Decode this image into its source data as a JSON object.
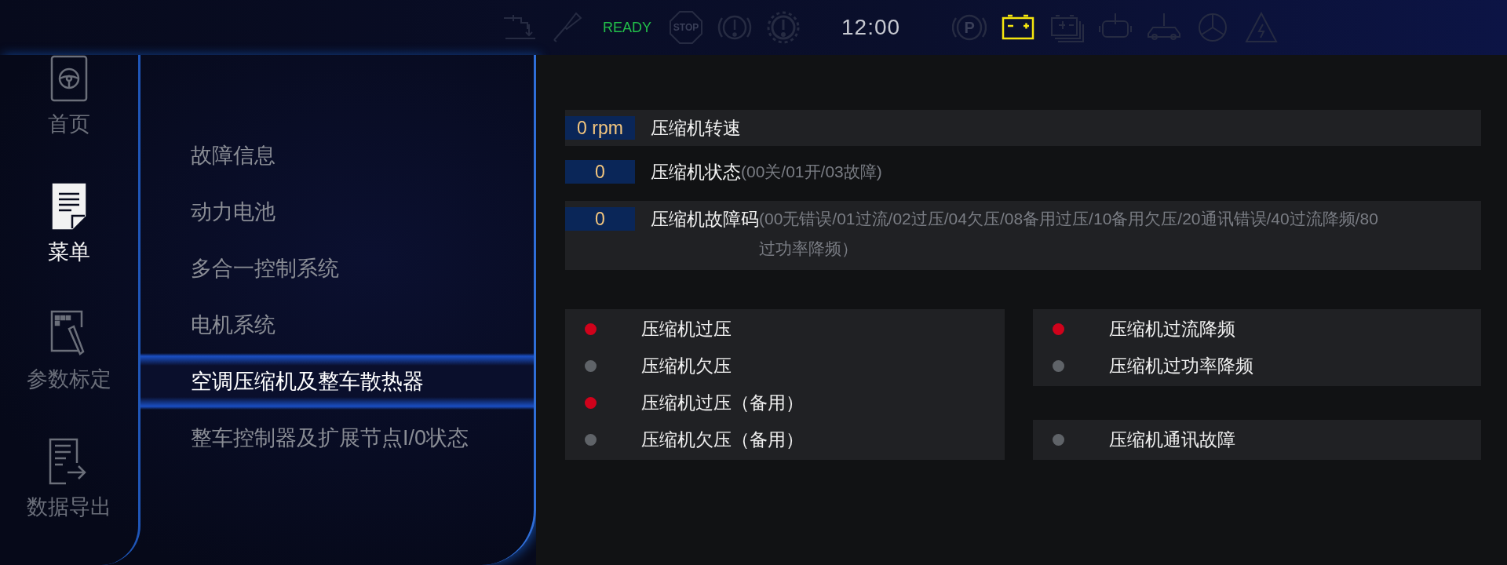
{
  "status_bar": {
    "indicators_left": [
      {
        "kind": "lift",
        "on": false
      },
      {
        "kind": "wrench",
        "on": false
      },
      {
        "kind": "ready",
        "label": "READY",
        "on": true
      },
      {
        "kind": "stop",
        "label": "STOP",
        "on": false
      },
      {
        "kind": "brake",
        "on": false
      },
      {
        "kind": "gear_warning",
        "on": false
      }
    ],
    "clock": "12:00",
    "indicators_right": [
      {
        "kind": "parking",
        "label": "P",
        "on": false
      },
      {
        "kind": "battery",
        "on": true
      },
      {
        "kind": "battery_pack",
        "on": false
      },
      {
        "kind": "tank",
        "on": false
      },
      {
        "kind": "car_lift",
        "on": false
      },
      {
        "kind": "wheel",
        "on": false
      },
      {
        "kind": "high_voltage",
        "on": false
      }
    ]
  },
  "rail": [
    {
      "kind": "home",
      "label": "首页",
      "selected": false
    },
    {
      "kind": "menu",
      "label": "菜单",
      "selected": true
    },
    {
      "kind": "calibrate",
      "label": "参数标定",
      "selected": false
    },
    {
      "kind": "export",
      "label": "数据导出",
      "selected": false
    }
  ],
  "menu": [
    {
      "label": "故障信息",
      "selected": false
    },
    {
      "label": "动力电池",
      "selected": false
    },
    {
      "label": "多合一控制系统",
      "selected": false
    },
    {
      "label": "电机系统",
      "selected": false
    },
    {
      "label": "空调压缩机及整车散热器",
      "selected": true
    },
    {
      "label": "整车控制器及扩展节点I/0状态",
      "selected": false
    }
  ],
  "parameters": [
    {
      "value": "0 rpm",
      "label": "压缩机转速"
    },
    {
      "value": "0",
      "label": "压缩机状态",
      "hint": "(00关/01开/03故障)"
    },
    {
      "value": "0",
      "label": "压缩机故障码",
      "hint": "(00无错误/01过流/02过压/04欠压/08备用过压/10备用欠压/20通讯错误/40过流降频/80过功率降频）"
    }
  ],
  "alarm_groups": [
    {
      "items": [
        {
          "label": "压缩机过压",
          "color": "#d0021b"
        },
        {
          "label": "压缩机欠压",
          "color": "#5f6368"
        },
        {
          "label": "压缩机过压（备用）",
          "color": "#d0021b"
        },
        {
          "label": "压缩机欠压（备用）",
          "color": "#5f6368"
        }
      ]
    },
    {
      "items": [
        {
          "label": "压缩机过流降频",
          "color": "#d0021b"
        },
        {
          "label": "压缩机过功率降频",
          "color": "#5f6368"
        }
      ]
    },
    {
      "items": [
        {
          "label": "压缩机通讯故障",
          "color": "#5f6368"
        }
      ]
    }
  ]
}
